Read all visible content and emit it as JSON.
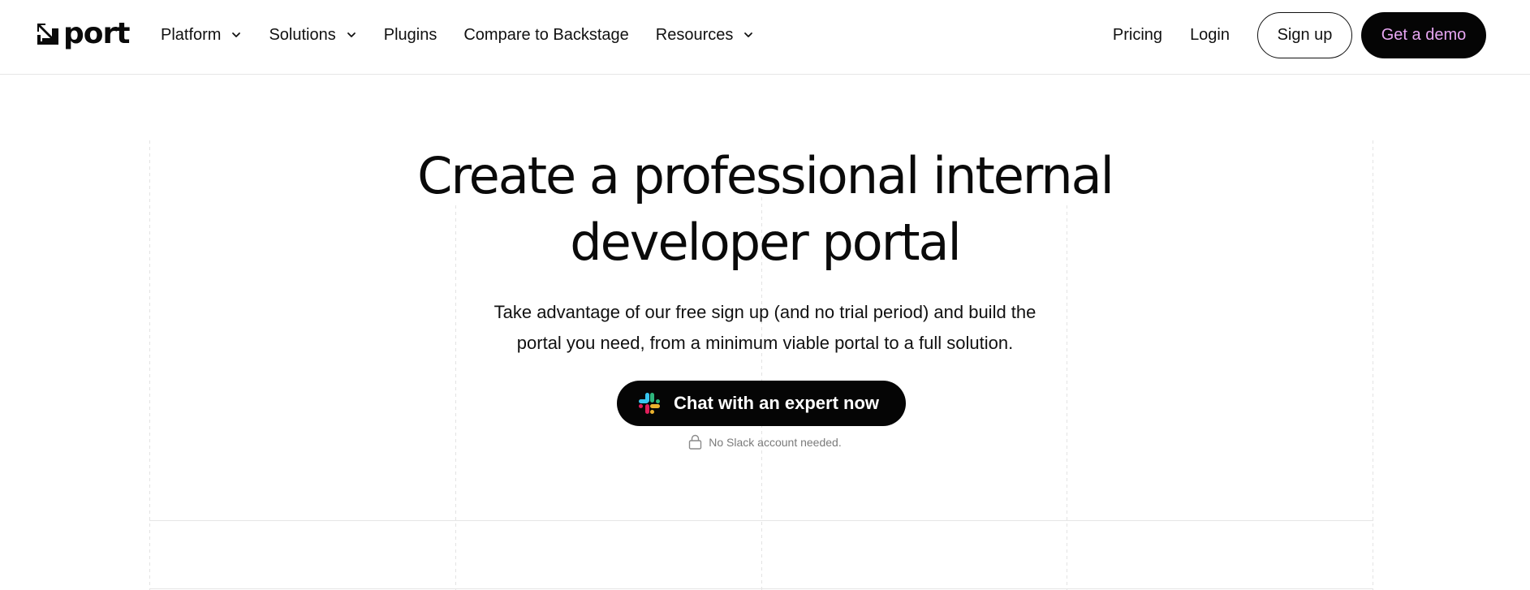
{
  "header": {
    "logo_text": "port",
    "nav": [
      {
        "label": "Platform",
        "has_dropdown": true
      },
      {
        "label": "Solutions",
        "has_dropdown": true
      },
      {
        "label": "Plugins",
        "has_dropdown": false
      },
      {
        "label": "Compare to Backstage",
        "has_dropdown": false
      },
      {
        "label": "Resources",
        "has_dropdown": true
      }
    ],
    "pricing_label": "Pricing",
    "login_label": "Login",
    "signup_label": "Sign up",
    "demo_label": "Get a demo"
  },
  "hero": {
    "title_line1": "Create a professional internal",
    "title_line2": "developer portal",
    "subtitle_line1": "Take advantage of our free sign up (and no trial period) and build the",
    "subtitle_line2": "portal you need, from a minimum viable portal to a full solution.",
    "cta_label": "Chat with an expert now",
    "note": "No Slack account needed."
  },
  "colors": {
    "accent_button_bg": "#050505",
    "demo_text": "#e7a6f2",
    "grid_line": "#e2e2e2"
  }
}
